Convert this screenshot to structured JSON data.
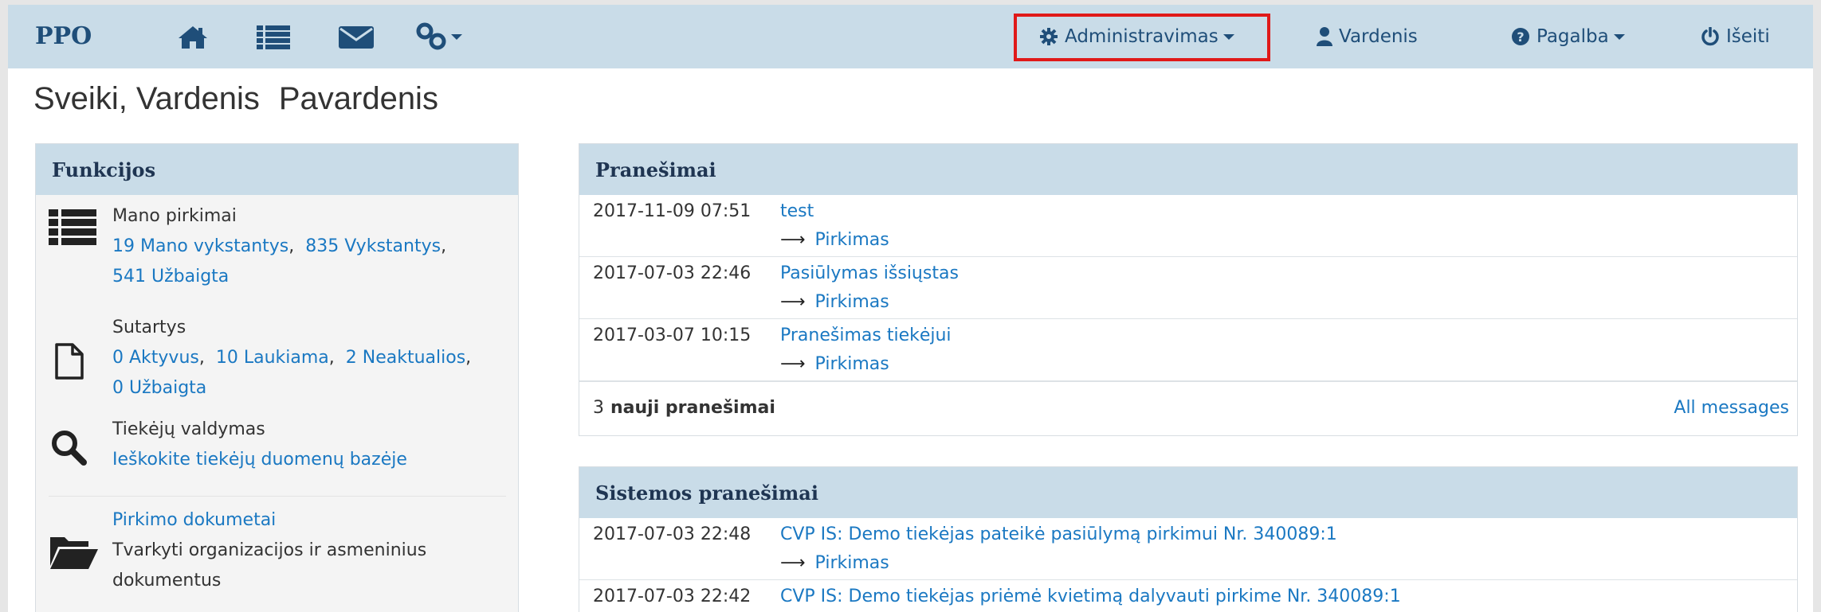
{
  "navbar": {
    "brand": "PPO",
    "icons": [
      "home-icon",
      "list-icon",
      "envelope-icon",
      "link-icon"
    ],
    "admin_label": "Administravimas",
    "user_label": "Vardenis",
    "help_label": "Pagalba",
    "logout_label": "Išeiti"
  },
  "greeting": {
    "first": "Sveiki, Vardenis",
    "last": "Pavardenis"
  },
  "functions": {
    "heading": "Funkcijos",
    "purchases": {
      "title": "Mano pirkimai",
      "links": [
        "19 Mano vykstantys",
        "835 Vykstantys",
        "541 Užbaigta"
      ]
    },
    "contracts": {
      "title": "Sutartys",
      "links": [
        "0 Aktyvus",
        "10 Laukiama",
        "2 Neaktualios",
        "0 Užbaigta"
      ]
    },
    "suppliers": {
      "title": "Tiekėjų valdymas",
      "link": "Ieškokite tiekėjų duomenų bazėje"
    },
    "documents": {
      "link": "Pirkimo dokumetai",
      "desc_line1": "Tvarkyti organizacijos ir asmeninius",
      "desc_line2": "dokumentus"
    }
  },
  "messages": {
    "heading": "Pranešimai",
    "items": [
      {
        "date": "2017-11-09 07:51",
        "title": "test",
        "link": "Pirkimas"
      },
      {
        "date": "2017-07-03 22:46",
        "title": "Pasiūlymas išsiųstas",
        "link": "Pirkimas"
      },
      {
        "date": "2017-03-07 10:15",
        "title": "Pranešimas tiekėjui",
        "link": "Pirkimas"
      }
    ],
    "new_count": "3",
    "new_label": "nauji pranešimai",
    "all_label": "All messages"
  },
  "system_messages": {
    "heading": "Sistemos pranešimai",
    "items": [
      {
        "date": "2017-07-03 22:48",
        "title": "CVP IS: Demo tiekėjas pateikė pasiūlymą pirkimui Nr. 340089:1",
        "link": "Pirkimas"
      },
      {
        "date": "2017-07-03 22:42",
        "title": "CVP IS: Demo tiekėjas priėmė kvietimą dalyvauti pirkime Nr. 340089:1",
        "link": ""
      }
    ]
  },
  "colors": {
    "navbar_bg": "#c9dce8",
    "link": "#1a78c2",
    "highlight": "#e01919"
  }
}
